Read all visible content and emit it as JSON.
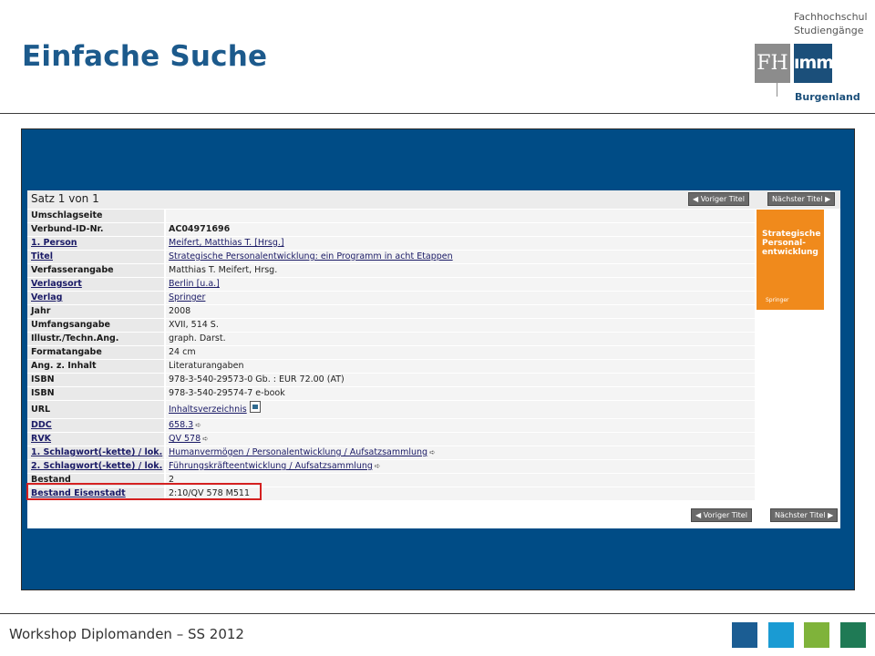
{
  "header": {
    "title": "Einfache Suche",
    "logo": {
      "line1": "Fachhochschul",
      "line2": "Studiengänge",
      "mark_left": "FH",
      "mark_right": "ımmı",
      "region": "Burgenland"
    }
  },
  "opac": {
    "record_label": "Satz 1 von 1",
    "prev_button": "◀ Voriger Titel",
    "next_button": "Nächster Titel ▶",
    "fields": [
      {
        "label": "Umschlagseite",
        "value": ""
      },
      {
        "label": "Verbund-ID-Nr.",
        "value": "AC04971696"
      },
      {
        "label": "1. Person",
        "value": "Meifert, Matthias T. [Hrsg.]"
      },
      {
        "label": "Titel",
        "value": "Strategische Personalentwicklung: ein Programm in acht Etappen"
      },
      {
        "label": "Verfasserangabe",
        "value": "Matthias T. Meifert, Hrsg."
      },
      {
        "label": "Verlagsort",
        "value": "Berlin [u.a.]"
      },
      {
        "label": "Verlag",
        "value": "Springer"
      },
      {
        "label": "Jahr",
        "value": "2008"
      },
      {
        "label": "Umfangsangabe",
        "value": "XVII, 514 S."
      },
      {
        "label": "Illustr./Techn.Ang.",
        "value": "graph. Darst."
      },
      {
        "label": "Formatangabe",
        "value": "24 cm"
      },
      {
        "label": "Ang. z. Inhalt",
        "value": "Literaturangaben"
      },
      {
        "label": "ISBN",
        "value": "978-3-540-29573-0 Gb. : EUR 72.00 (AT)"
      },
      {
        "label": "ISBN",
        "value": "978-3-540-29574-7 e-book"
      },
      {
        "label": "URL",
        "value": "Inhaltsverzeichnis"
      },
      {
        "label": "DDC",
        "value": "658.3"
      },
      {
        "label": "RVK",
        "value": "QV 578"
      },
      {
        "label": "1. Schlagwort(-kette) / lok.",
        "value": "Humanvermögen / Personalentwicklung / Aufsatzsammlung"
      },
      {
        "label": "2. Schlagwort(-kette) / lok.",
        "value": "Führungskräfteentwicklung / Aufsatzsammlung"
      },
      {
        "label": "Bestand",
        "value": "2"
      },
      {
        "label": "Bestand Eisenstadt",
        "value": "2:10/QV 578 M511"
      }
    ],
    "cover": {
      "title": "Strategische Personal-entwicklung",
      "publisher": "Springer"
    }
  },
  "footer": {
    "text": "Workshop Diplomanden – SS 2012",
    "colors": [
      "#1b5d93",
      "#1a9bd3",
      "#7fb33a",
      "#1f7a55"
    ]
  }
}
